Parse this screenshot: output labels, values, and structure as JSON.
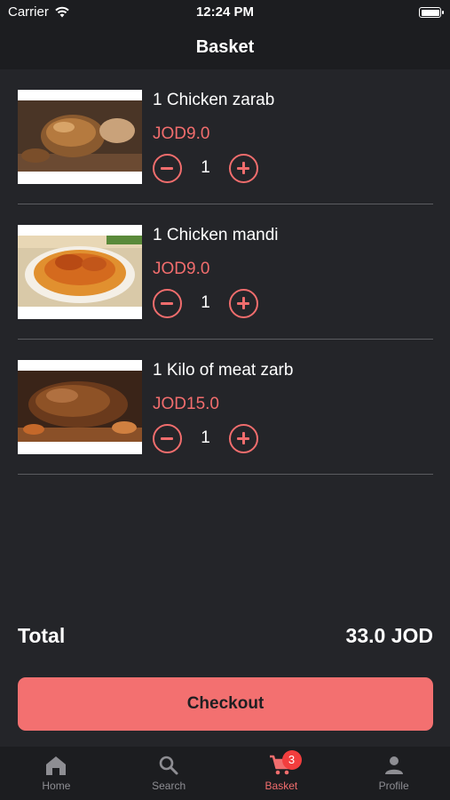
{
  "status_bar": {
    "carrier": "Carrier",
    "time": "12:24 PM"
  },
  "header": {
    "title": "Basket"
  },
  "items": [
    {
      "name": "1 Chicken zarab",
      "price": "JOD9.0",
      "quantity": "1"
    },
    {
      "name": "1 Chicken mandi",
      "price": "JOD9.0",
      "quantity": "1"
    },
    {
      "name": "1 Kilo of meat zarb",
      "price": "JOD15.0",
      "quantity": "1"
    }
  ],
  "summary": {
    "total_label": "Total",
    "total_value": "33.0 JOD"
  },
  "checkout_label": "Checkout",
  "tabs": [
    {
      "label": "Home",
      "icon": "home-icon"
    },
    {
      "label": "Search",
      "icon": "search-icon"
    },
    {
      "label": "Basket",
      "icon": "cart-icon",
      "badge": "3",
      "active": true
    },
    {
      "label": "Profile",
      "icon": "person-icon"
    }
  ],
  "colors": {
    "accent": "#f16d6d",
    "button": "#f37070",
    "background": "#242529",
    "bar": "#1c1d20"
  }
}
